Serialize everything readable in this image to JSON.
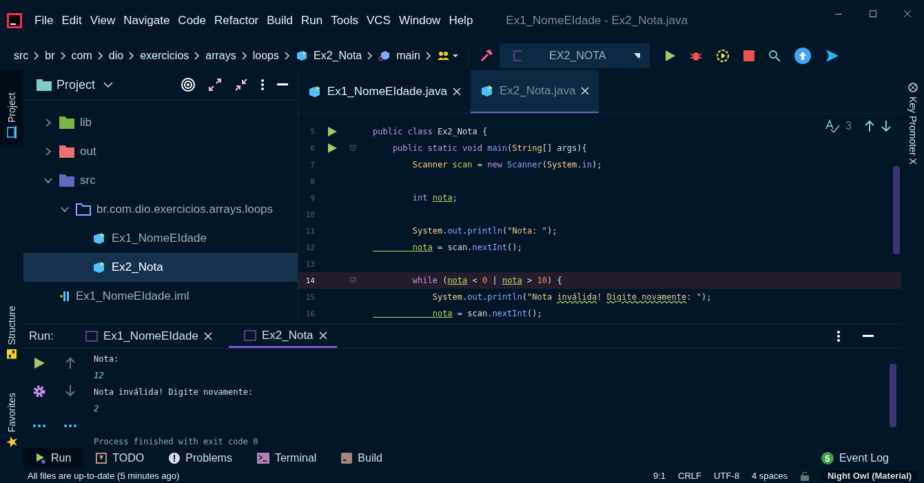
{
  "menu": [
    "File",
    "Edit",
    "View",
    "Navigate",
    "Code",
    "Refactor",
    "Build",
    "Run",
    "Tools",
    "VCS",
    "Window",
    "Help"
  ],
  "window": {
    "title": "Ex1_NomeEIdade - Ex2_Nota.java"
  },
  "breadcrumbs": [
    "src",
    "br",
    "com",
    "dio",
    "exercicios",
    "arrays",
    "loops",
    "Ex2_Nota",
    "main"
  ],
  "run_config": "EX2_NOTA",
  "left_tool_tabs": [
    {
      "label": "Project",
      "selected": true
    },
    {
      "label": "Structure",
      "selected": false
    },
    {
      "label": "Favorites",
      "selected": false
    }
  ],
  "project": {
    "title": "Project",
    "tree": [
      {
        "label": "lib",
        "kind": "lib",
        "expanded": false,
        "selected": false
      },
      {
        "label": "out",
        "kind": "out",
        "expanded": false,
        "selected": false
      },
      {
        "label": "src",
        "kind": "src",
        "expanded": true,
        "selected": false,
        "children": [
          {
            "label": "br.com.dio.exercicios.arrays.loops",
            "kind": "package",
            "expanded": true,
            "selected": false,
            "children": [
              {
                "label": "Ex1_NomeEIdade",
                "kind": "class",
                "selected": false
              },
              {
                "label": "Ex2_Nota",
                "kind": "class",
                "selected": true
              }
            ]
          }
        ]
      },
      {
        "label": "Ex1_NomeEIdade.iml",
        "kind": "iml",
        "selected": false
      }
    ]
  },
  "editor": {
    "tabs": [
      {
        "label": "Ex1_NomeEIdade.java",
        "selected": false
      },
      {
        "label": "Ex2_Nota.java",
        "selected": true
      }
    ],
    "problems": "3",
    "lines": [
      {
        "n": "5",
        "run": true,
        "fold": false,
        "current": false,
        "tokens": [
          {
            "t": "public class ",
            "kind": "keyword"
          },
          {
            "t": "Ex2_Nota {",
            "kind": "plain"
          }
        ]
      },
      {
        "n": "6",
        "run": true,
        "fold": true,
        "current": false,
        "tokens": [
          {
            "t": "    public static void ",
            "kind": "keyword"
          },
          {
            "t": "main",
            "kind": "method"
          },
          {
            "t": "(",
            "kind": "plain"
          },
          {
            "t": "String",
            "kind": "type"
          },
          {
            "t": "[] args){",
            "kind": "plain"
          }
        ]
      },
      {
        "n": "7",
        "run": false,
        "fold": false,
        "current": false,
        "tokens": [
          {
            "t": "        Scanner ",
            "kind": "type"
          },
          {
            "t": "scan",
            "kind": "variable"
          },
          {
            "t": " = ",
            "kind": "plain"
          },
          {
            "t": "new ",
            "kind": "keyword"
          },
          {
            "t": "Scanner",
            "kind": "method"
          },
          {
            "t": "(",
            "kind": "plain"
          },
          {
            "t": "System",
            "kind": "type"
          },
          {
            "t": ".",
            "kind": "plain"
          },
          {
            "t": "in",
            "kind": "method"
          },
          {
            "t": ");",
            "kind": "plain"
          }
        ]
      },
      {
        "n": "8",
        "run": false,
        "fold": false,
        "current": false
      },
      {
        "n": "9",
        "run": false,
        "fold": false,
        "current": false,
        "tokens": [
          {
            "t": "        int ",
            "kind": "keyword"
          },
          {
            "t": "nota",
            "kind": "mutable"
          },
          {
            "t": ";",
            "kind": "plain"
          }
        ]
      },
      {
        "n": "10",
        "run": false,
        "fold": false,
        "current": false
      },
      {
        "n": "11",
        "run": false,
        "fold": false,
        "current": false,
        "tokens": [
          {
            "t": "        System",
            "kind": "type"
          },
          {
            "t": ".",
            "kind": "plain"
          },
          {
            "t": "out",
            "kind": "method"
          },
          {
            "t": ".",
            "kind": "plain"
          },
          {
            "t": "println",
            "kind": "method"
          },
          {
            "t": "(",
            "kind": "plain"
          },
          {
            "t": "\"Nota: \"",
            "kind": "string"
          },
          {
            "t": ");",
            "kind": "plain"
          }
        ]
      },
      {
        "n": "12",
        "run": false,
        "fold": false,
        "current": false,
        "tokens": [
          {
            "t": "        nota",
            "kind": "mutable"
          },
          {
            "t": " = scan.",
            "kind": "plain"
          },
          {
            "t": "nextInt",
            "kind": "method"
          },
          {
            "t": "();",
            "kind": "plain"
          }
        ]
      },
      {
        "n": "13",
        "run": false,
        "fold": false,
        "current": false
      },
      {
        "n": "14",
        "run": false,
        "fold": true,
        "current": true,
        "tokens": [
          {
            "t": "        while ",
            "kind": "keyword"
          },
          {
            "t": "(",
            "kind": "plain"
          },
          {
            "t": "nota",
            "kind": "mutable"
          },
          {
            "t": " < ",
            "kind": "plain"
          },
          {
            "t": "0",
            "kind": "number"
          },
          {
            "t": " | ",
            "kind": "plain"
          },
          {
            "t": "nota",
            "kind": "mutable"
          },
          {
            "t": " > ",
            "kind": "plain"
          },
          {
            "t": "10",
            "kind": "number"
          },
          {
            "t": ") {",
            "kind": "plain"
          }
        ]
      },
      {
        "n": "15",
        "run": false,
        "fold": false,
        "current": false,
        "tokens": [
          {
            "t": "            System",
            "kind": "type"
          },
          {
            "t": ".",
            "kind": "plain"
          },
          {
            "t": "out",
            "kind": "method"
          },
          {
            "t": ".",
            "kind": "plain"
          },
          {
            "t": "println",
            "kind": "method"
          },
          {
            "t": "(",
            "kind": "plain"
          },
          {
            "t": "\"Nota ",
            "kind": "string"
          },
          {
            "t": "inválida",
            "kind": "typo"
          },
          {
            "t": "! ",
            "kind": "string"
          },
          {
            "t": "Digite",
            "kind": "typo"
          },
          {
            "t": " novamente",
            "kind": "typo"
          },
          {
            "t": ": \"",
            "kind": "string"
          },
          {
            "t": ");",
            "kind": "plain"
          }
        ]
      },
      {
        "n": "16",
        "run": false,
        "fold": false,
        "current": false,
        "tokens": [
          {
            "t": "            nota",
            "kind": "mutable"
          },
          {
            "t": " = scan.",
            "kind": "plain"
          },
          {
            "t": "nextInt",
            "kind": "method"
          },
          {
            "t": "();",
            "kind": "plain"
          }
        ]
      }
    ]
  },
  "right_tool_tab": "Key Promoter X",
  "run_panel": {
    "label": "Run:",
    "tabs": [
      {
        "label": "Ex1_NomeEIdade",
        "selected": false
      },
      {
        "label": "Ex2_Nota",
        "selected": true
      }
    ],
    "console": [
      {
        "text": "Nota:",
        "kind": "output"
      },
      {
        "text": "12",
        "kind": "input"
      },
      {
        "text": "Nota inválida! Digite novamente:",
        "kind": "output"
      },
      {
        "text": "2",
        "kind": "input"
      },
      {
        "text": "Process finished with exit code 0",
        "kind": "system"
      }
    ]
  },
  "tool_tabs": [
    {
      "label": "Run",
      "kind": "run",
      "selected": true
    },
    {
      "label": "TODO",
      "kind": "todo",
      "selected": false
    },
    {
      "label": "Problems",
      "kind": "problems",
      "selected": false
    },
    {
      "label": "Terminal",
      "kind": "terminal",
      "selected": false
    },
    {
      "label": "Build",
      "kind": "build",
      "selected": false
    }
  ],
  "event_log": {
    "label": "Event Log",
    "count": "5"
  },
  "status_bar": {
    "message": "All files are up-to-date (5 minutes ago)",
    "items": [
      "9:1",
      "CRLF",
      "UTF-8",
      "4 spaces"
    ],
    "theme": "Night Owl (Material)"
  }
}
